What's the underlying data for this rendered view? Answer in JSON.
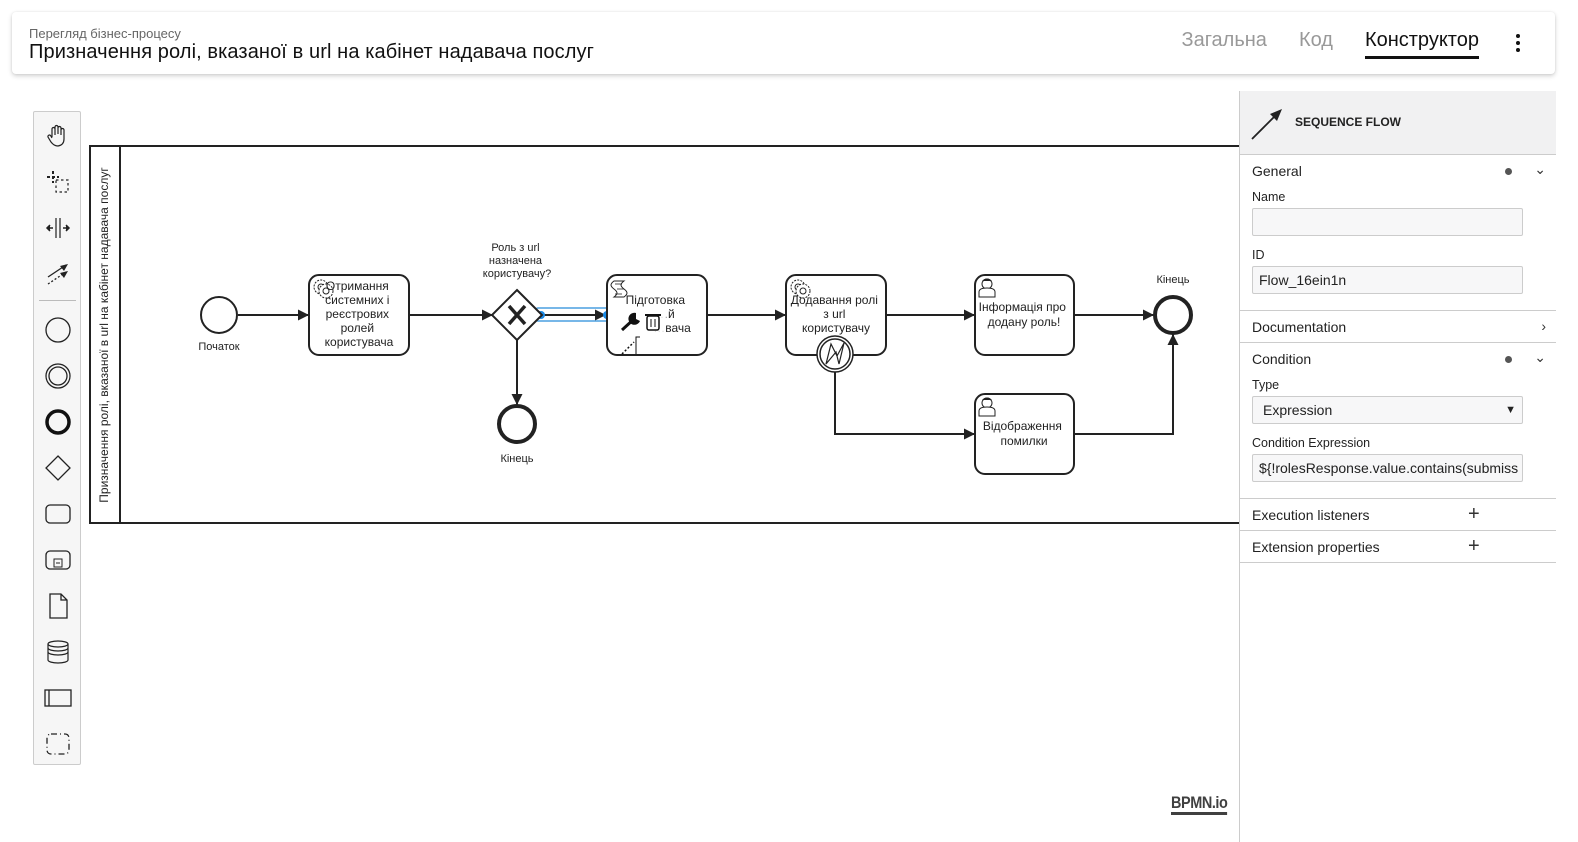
{
  "header": {
    "subtitle": "Перегляд бізнес-процесу",
    "title": "Призначення ролі, вказаної в url на кабінет надавача послуг",
    "tabs": [
      {
        "label": "Загальна",
        "active": false
      },
      {
        "label": "Код",
        "active": false
      },
      {
        "label": "Конструктор",
        "active": true
      }
    ],
    "menu_icon": "more-vertical-icon"
  },
  "palette": {
    "tools": [
      {
        "name": "hand-tool",
        "icon": "hand-icon"
      },
      {
        "name": "lasso-tool",
        "icon": "lasso-icon"
      },
      {
        "name": "space-tool",
        "icon": "space-icon"
      },
      {
        "name": "global-connect-tool",
        "icon": "connect-icon"
      },
      {
        "name": "create-start-event",
        "icon": "start-event-icon"
      },
      {
        "name": "create-intermediate-event",
        "icon": "intermediate-event-icon"
      },
      {
        "name": "create-end-event",
        "icon": "end-event-icon"
      },
      {
        "name": "create-gateway",
        "icon": "gateway-icon"
      },
      {
        "name": "create-task",
        "icon": "task-icon"
      },
      {
        "name": "create-subprocess",
        "icon": "subprocess-icon"
      },
      {
        "name": "create-data-object",
        "icon": "data-object-icon"
      },
      {
        "name": "create-data-store",
        "icon": "data-store-icon"
      },
      {
        "name": "create-pool",
        "icon": "pool-icon"
      },
      {
        "name": "create-group",
        "icon": "group-icon"
      }
    ]
  },
  "diagram": {
    "pool_label": "Призначення ролі, вказаної в url на кабінет надавача послуг",
    "start_event": {
      "label": "Початок"
    },
    "task_get_roles": {
      "lines": [
        "Отримання",
        "системних і",
        "реєстрових",
        "ролей",
        "користувача"
      ],
      "type": "service"
    },
    "gateway": {
      "lines": [
        "Роль з url",
        "назначена",
        "користувачу?"
      ]
    },
    "end_event_1": {
      "label": "Кінець"
    },
    "task_prepare": {
      "lines": [
        "Підготовка",
        "…й",
        "…вача"
      ],
      "type": "script"
    },
    "task_add_role": {
      "lines": [
        "Додавання ролі",
        "з url",
        "користувачу"
      ],
      "type": "service"
    },
    "task_info": {
      "lines": [
        "Інформація про",
        "додану роль!"
      ],
      "type": "user"
    },
    "task_error": {
      "lines": [
        "Відображення",
        "помилки"
      ],
      "type": "user"
    },
    "end_event_2": {
      "label": "Кінець"
    },
    "selected_flow_id": "Flow_16ein1n"
  },
  "watermark": "BPMN.io",
  "properties": {
    "element_type": "SEQUENCE FLOW",
    "groups": {
      "general": {
        "label": "General",
        "has_data": true,
        "expanded": true
      },
      "documentation": {
        "label": "Documentation",
        "expanded": false
      },
      "condition": {
        "label": "Condition",
        "has_data": true,
        "expanded": true
      },
      "execution_listeners": {
        "label": "Execution listeners"
      },
      "extension_properties": {
        "label": "Extension properties"
      }
    },
    "fields": {
      "name_label": "Name",
      "name_value": "",
      "id_label": "ID",
      "id_value": "Flow_16ein1n",
      "type_label": "Type",
      "type_value": "Expression",
      "condition_label": "Condition Expression",
      "condition_value": "${!rolesResponse.value.contains(submiss"
    }
  }
}
